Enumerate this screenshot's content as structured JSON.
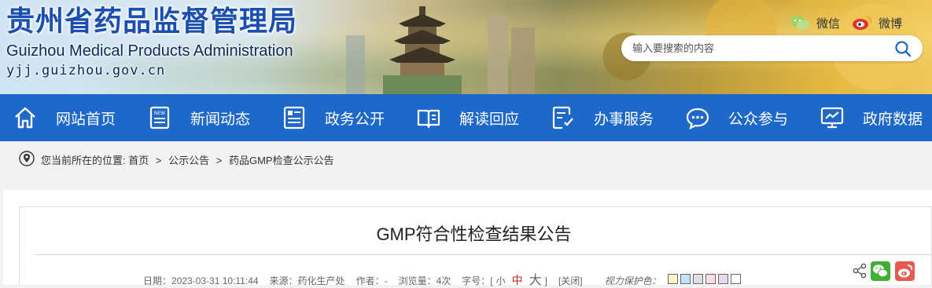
{
  "header": {
    "site_title": "贵州省药品监督管理局",
    "site_title_en": "Guizhou Medical Products Administration",
    "site_url": "yjj.guizhou.gov.cn",
    "wechat_label": "微信",
    "weibo_label": "微博",
    "search_placeholder": "输入要搜索的内容"
  },
  "nav": {
    "items": [
      {
        "label": "网站首页",
        "icon": "home-icon"
      },
      {
        "label": "新闻动态",
        "icon": "news-icon"
      },
      {
        "label": "政务公开",
        "icon": "document-list-icon"
      },
      {
        "label": "解读回应",
        "icon": "open-book-icon"
      },
      {
        "label": "办事服务",
        "icon": "service-form-icon"
      },
      {
        "label": "公众参与",
        "icon": "chat-bubble-icon"
      },
      {
        "label": "政府数据",
        "icon": "data-monitor-icon"
      }
    ]
  },
  "breadcrumb": {
    "prefix": "您当前所在的位置:",
    "items": [
      "首页",
      "公示公告",
      "药品GMP检查公示公告"
    ],
    "separator": ">"
  },
  "article": {
    "title": "GMP符合性检查结果公告",
    "date": "日期：2023-03-31 10:11:44",
    "source": "来源：药化生产处",
    "author": "作者：-",
    "views": "浏览量：4次",
    "font_size_label": "字号：[",
    "font_small": "小",
    "font_mid": "中",
    "font_big": "大",
    "font_close_bracket": "]",
    "close_label": "[关闭]",
    "eye_label": "视力保护色：",
    "eye_colors": [
      "#fbf5c8",
      "#bde3f5",
      "#dde1e6",
      "#f8dde6",
      "#e8d8f0",
      "#ffffff"
    ]
  },
  "colors": {
    "nav_bg": "#1d68c9",
    "title_blue": "#1a4fb0",
    "accent_red": "#c0281e"
  }
}
